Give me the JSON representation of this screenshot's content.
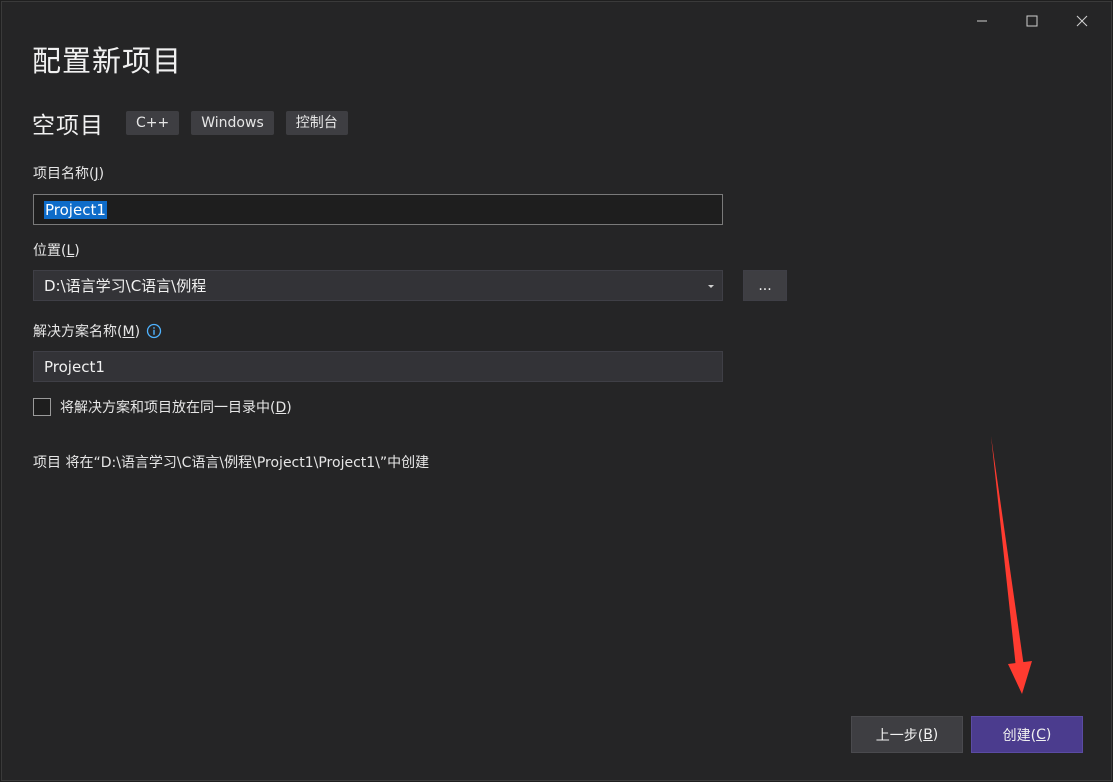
{
  "dialog": {
    "title": "配置新项目"
  },
  "template": {
    "name": "空项目",
    "tags": [
      "C++",
      "Windows",
      "控制台"
    ]
  },
  "project_name": {
    "label": "项目名称(",
    "accel": "J",
    "label_end": ")",
    "value": "Project1"
  },
  "location": {
    "label": "位置(",
    "accel": "L",
    "label_end": ")",
    "value": "D:\\语言学习\\C语言\\例程",
    "browse_label": "..."
  },
  "solution_name": {
    "label": "解决方案名称(",
    "accel": "M",
    "label_end": ")",
    "value": "Project1"
  },
  "same_dir": {
    "label": "将解决方案和项目放在同一目录中(",
    "accel": "D",
    "label_end": ")",
    "checked": false
  },
  "path_info": "项目 将在“D:\\语言学习\\C语言\\例程\\Project1\\Project1\\”中创建",
  "buttons": {
    "back": {
      "label": "上一步(",
      "accel": "B",
      "label_end": ")"
    },
    "create": {
      "label": "创建(",
      "accel": "C",
      "label_end": ")"
    }
  },
  "colors": {
    "accent": "#4b3c8e",
    "selection": "#0e6cc9",
    "annotation": "#ff3b30"
  },
  "icons": {
    "minimize": "minimize-icon",
    "maximize": "maximize-icon",
    "close": "close-icon",
    "dropdown": "chevron-down-icon",
    "info": "info-icon"
  }
}
